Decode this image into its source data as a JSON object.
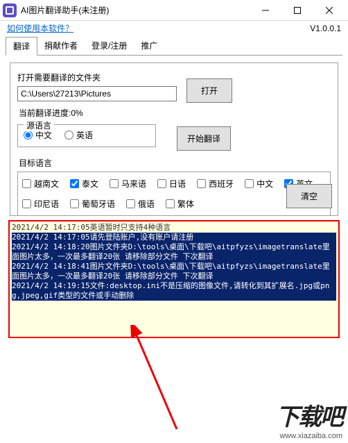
{
  "window": {
    "title": "AI图片翻译助手(未注册)"
  },
  "topbar": {
    "help": "如何使用本软件？",
    "version": "V1.0.0.1"
  },
  "tabs": {
    "t0": "翻译",
    "t1": "捐献作者",
    "t2": "登录/注册",
    "t3": "推广"
  },
  "folder": {
    "label": "打开需要翻译的文件夹",
    "path": "C:\\Users\\27213\\Pictures",
    "open_btn": "打开"
  },
  "progress": {
    "text": "当前翻译进度:0%"
  },
  "src": {
    "title": "源语言",
    "zh": "中文",
    "en": "英语",
    "start": "开始翻译"
  },
  "target": {
    "title": "目标语言",
    "vi": "越南文",
    "th": "泰文",
    "ms": "马来语",
    "ja": "日语",
    "es": "西班牙",
    "zh": "中文",
    "en": "英文",
    "id": "印尼语",
    "pt": "葡萄牙语",
    "ru": "俄语",
    "tc": "繁体"
  },
  "clear": "清空",
  "log": {
    "l0": "2021/4/2 14:17:05英语暂时只支持4种语言",
    "l1": "2021/4/2 14:17:05请先登陆账户,没有账户请注册",
    "l2": "2021/4/2 14:18:20图片文件夹D:\\tools\\桌面\\下载吧\\aitpfyzs\\imagetranslate里面图片太多，一次最多翻译20张 请移除部分文件 下次翻译",
    "l3": "2021/4/2 14:18:41图片文件夹D:\\tools\\桌面\\下载吧\\aitpfyzs\\imagetranslate里面图片太多，一次最多翻译20张 请移除部分文件 下次翻译",
    "l4": "2021/4/2 14:19:15文件:desktop.ini不是压缩的图像文件,请转化到其扩展名.jpg或png,jpeg,gif类型的文件或手动删除"
  },
  "watermark": {
    "big": "下载吧",
    "url": "www.xiazaiba.com"
  }
}
